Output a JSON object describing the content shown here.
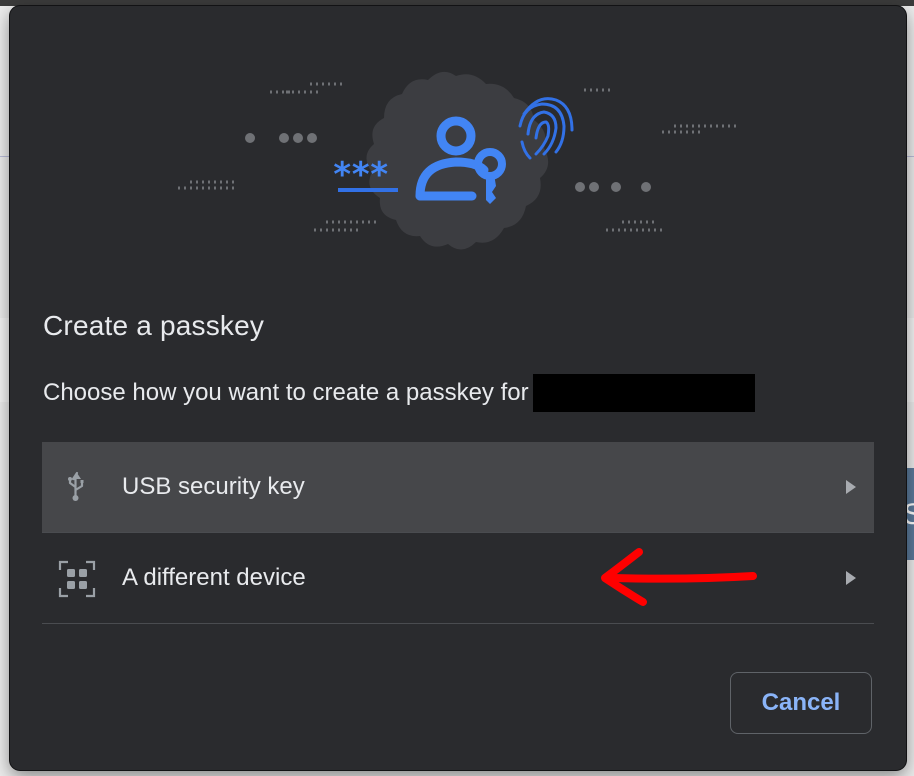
{
  "dialog": {
    "title": "Create a passkey",
    "subtitle": "Choose how you want to create a passkey for",
    "password_mask": "***",
    "options": [
      {
        "label": "USB security key",
        "icon": "usb-icon",
        "selected": true
      },
      {
        "label": "A different device",
        "icon": "qr-code-icon",
        "selected": false
      }
    ],
    "cancel_label": "Cancel"
  },
  "colors": {
    "dialog_bg": "#2a2b2e",
    "selected_row_bg": "#46474a",
    "text": "#e8eaed",
    "accent_blue": "#8ab4f8",
    "illustration_blue": "#4285f4",
    "annotation_red": "#ff0000"
  }
}
